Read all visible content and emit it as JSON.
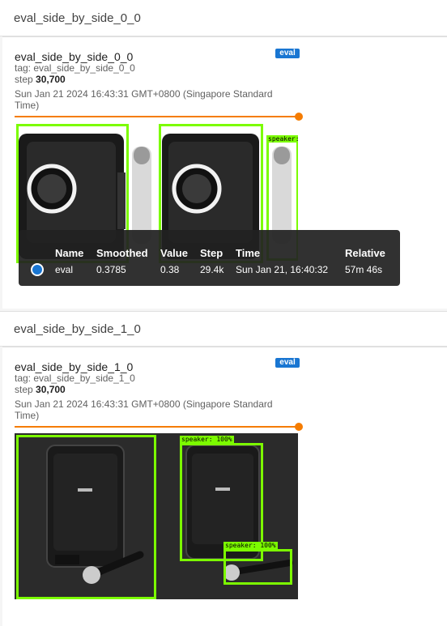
{
  "section1": {
    "title": "eval_side_by_side_0_0"
  },
  "card1": {
    "title": "eval_side_by_side_0_0",
    "tag": "tag: eval_side_by_side_0_0",
    "step_label": "step",
    "step_value": "30,700",
    "timestamp_line1": "Sun Jan 21 2024 16:43:31 GMT+0800 (Singapore Standard",
    "timestamp_line2": "Time)",
    "run_badge": "eval",
    "detections": [
      {
        "label": "speaker:"
      }
    ]
  },
  "tooltip": {
    "headers": {
      "name": "Name",
      "smoothed": "Smoothed",
      "value": "Value",
      "step": "Step",
      "time": "Time",
      "relative": "Relative"
    },
    "row": {
      "name": "eval",
      "smoothed": "0.3785",
      "value": "0.38",
      "step": "29.4k",
      "time": "Sun Jan 21, 16:40:32",
      "relative": "57m 46s",
      "color": "#1976d2"
    }
  },
  "section2": {
    "title": "eval_side_by_side_1_0"
  },
  "card2": {
    "title": "eval_side_by_side_1_0",
    "tag": "tag: eval_side_by_side_1_0",
    "step_label": "step",
    "step_value": "30,700",
    "timestamp_line1": "Sun Jan 21 2024 16:43:31 GMT+0800 (Singapore Standard",
    "timestamp_line2": "Time)",
    "run_badge": "eval",
    "detections": [
      {
        "label": "speaker: 100%"
      },
      {
        "label": "speaker: 100%"
      }
    ]
  },
  "colors": {
    "accent": "#f57c00",
    "bbox": "#7cfc00",
    "badge": "#1976d2"
  }
}
